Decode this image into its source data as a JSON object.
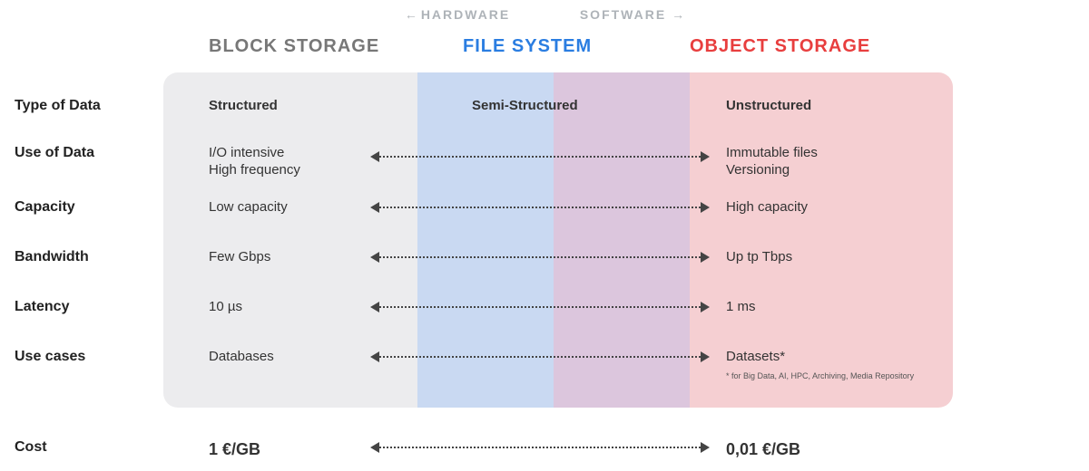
{
  "top": {
    "hardware": "HARDWARE",
    "software": "SOFTWARE"
  },
  "headers": {
    "block": "BLOCK STORAGE",
    "file": "FILE SYSTEM",
    "object": "OBJECT STORAGE"
  },
  "rows": {
    "type": {
      "label": "Type of Data",
      "left": "Structured",
      "mid": "Semi-Structured",
      "right": "Unstructured"
    },
    "use": {
      "label": "Use of Data",
      "left": "I/O intensive\nHigh frequency",
      "right": "Immutable files\nVersioning"
    },
    "capacity": {
      "label": "Capacity",
      "left": "Low capacity",
      "right": "High capacity"
    },
    "bandwidth": {
      "label": "Bandwidth",
      "left": "Few Gbps",
      "right": "Up tp Tbps"
    },
    "latency": {
      "label": "Latency",
      "left": "10 µs",
      "right": "1 ms"
    },
    "usecases": {
      "label": "Use cases",
      "left": "Databases",
      "right": "Datasets*",
      "footnote": "* for Big Data, AI, HPC, Archiving, Media Repository"
    },
    "cost": {
      "label": "Cost",
      "left": "1 €/GB",
      "right": "0,01 €/GB"
    }
  }
}
